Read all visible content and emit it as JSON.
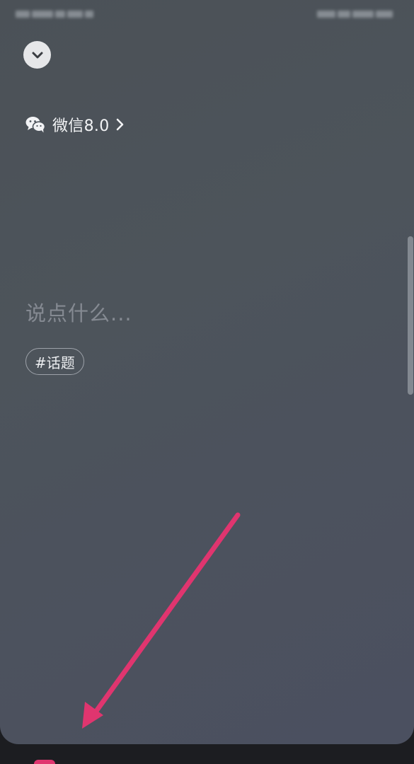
{
  "header": {
    "collapse_icon": "chevron-down-icon"
  },
  "app": {
    "icon": "wechat-icon",
    "name": "微信8.0",
    "chevron_icon": "chevron-right-icon"
  },
  "compose": {
    "placeholder": "说点什么..."
  },
  "topic": {
    "label": "#话题"
  },
  "colors": {
    "background": "#4d535b",
    "annotation_arrow": "#e0356f",
    "bottom_bar": "#1c1d21"
  }
}
